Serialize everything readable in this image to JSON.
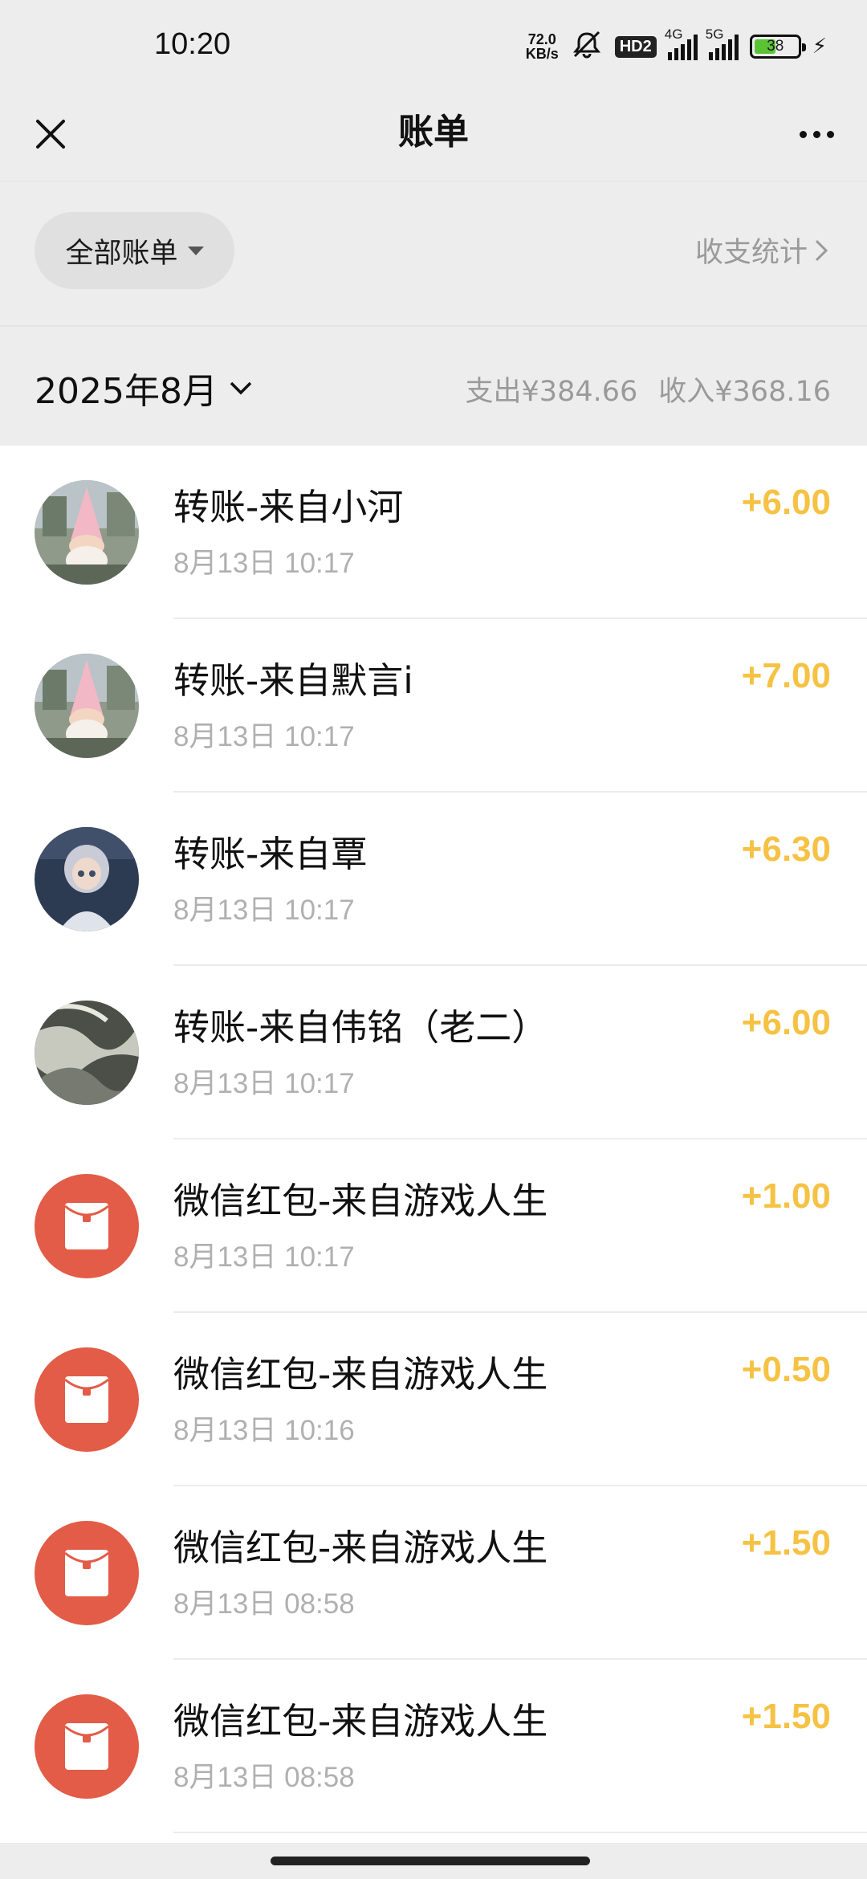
{
  "status_bar": {
    "time": "10:20",
    "net_speed_value": "72.0",
    "net_speed_unit": "KB/s",
    "hd_label": "HD2",
    "signal1_label": "4G",
    "signal2_label": "5G",
    "battery": "38"
  },
  "nav": {
    "title": "账单",
    "close_icon": "close-icon",
    "more_icon": "more-icon"
  },
  "filter": {
    "label": "全部账单",
    "stats_label": "收支统计"
  },
  "month": {
    "label": "2025年8月",
    "expense": "支出¥384.66",
    "income": "收入¥368.16"
  },
  "transactions": [
    {
      "title": "转账-来自小河",
      "time": "8月13日 10:17",
      "amount": "+6.00",
      "avatar": "gnome-photo"
    },
    {
      "title": "转账-来自默言i",
      "time": "8月13日 10:17",
      "amount": "+7.00",
      "avatar": "gnome-photo"
    },
    {
      "title": "转账-来自覃",
      "time": "8月13日 10:17",
      "amount": "+6.30",
      "avatar": "character-photo"
    },
    {
      "title": "转账-来自伟铭（老二）",
      "time": "8月13日 10:17",
      "amount": "+6.00",
      "avatar": "abstract-photo"
    },
    {
      "title": "微信红包-来自游戏人生",
      "time": "8月13日 10:17",
      "amount": "+1.00",
      "avatar": "red-packet-icon"
    },
    {
      "title": "微信红包-来自游戏人生",
      "time": "8月13日 10:16",
      "amount": "+0.50",
      "avatar": "red-packet-icon"
    },
    {
      "title": "微信红包-来自游戏人生",
      "time": "8月13日 08:58",
      "amount": "+1.50",
      "avatar": "red-packet-icon"
    },
    {
      "title": "微信红包-来自游戏人生",
      "time": "8月13日 08:58",
      "amount": "+1.50",
      "avatar": "red-packet-icon"
    }
  ],
  "colors": {
    "amount": "#f6c244",
    "red_packet": "#e25c47",
    "background": "#ededed"
  }
}
